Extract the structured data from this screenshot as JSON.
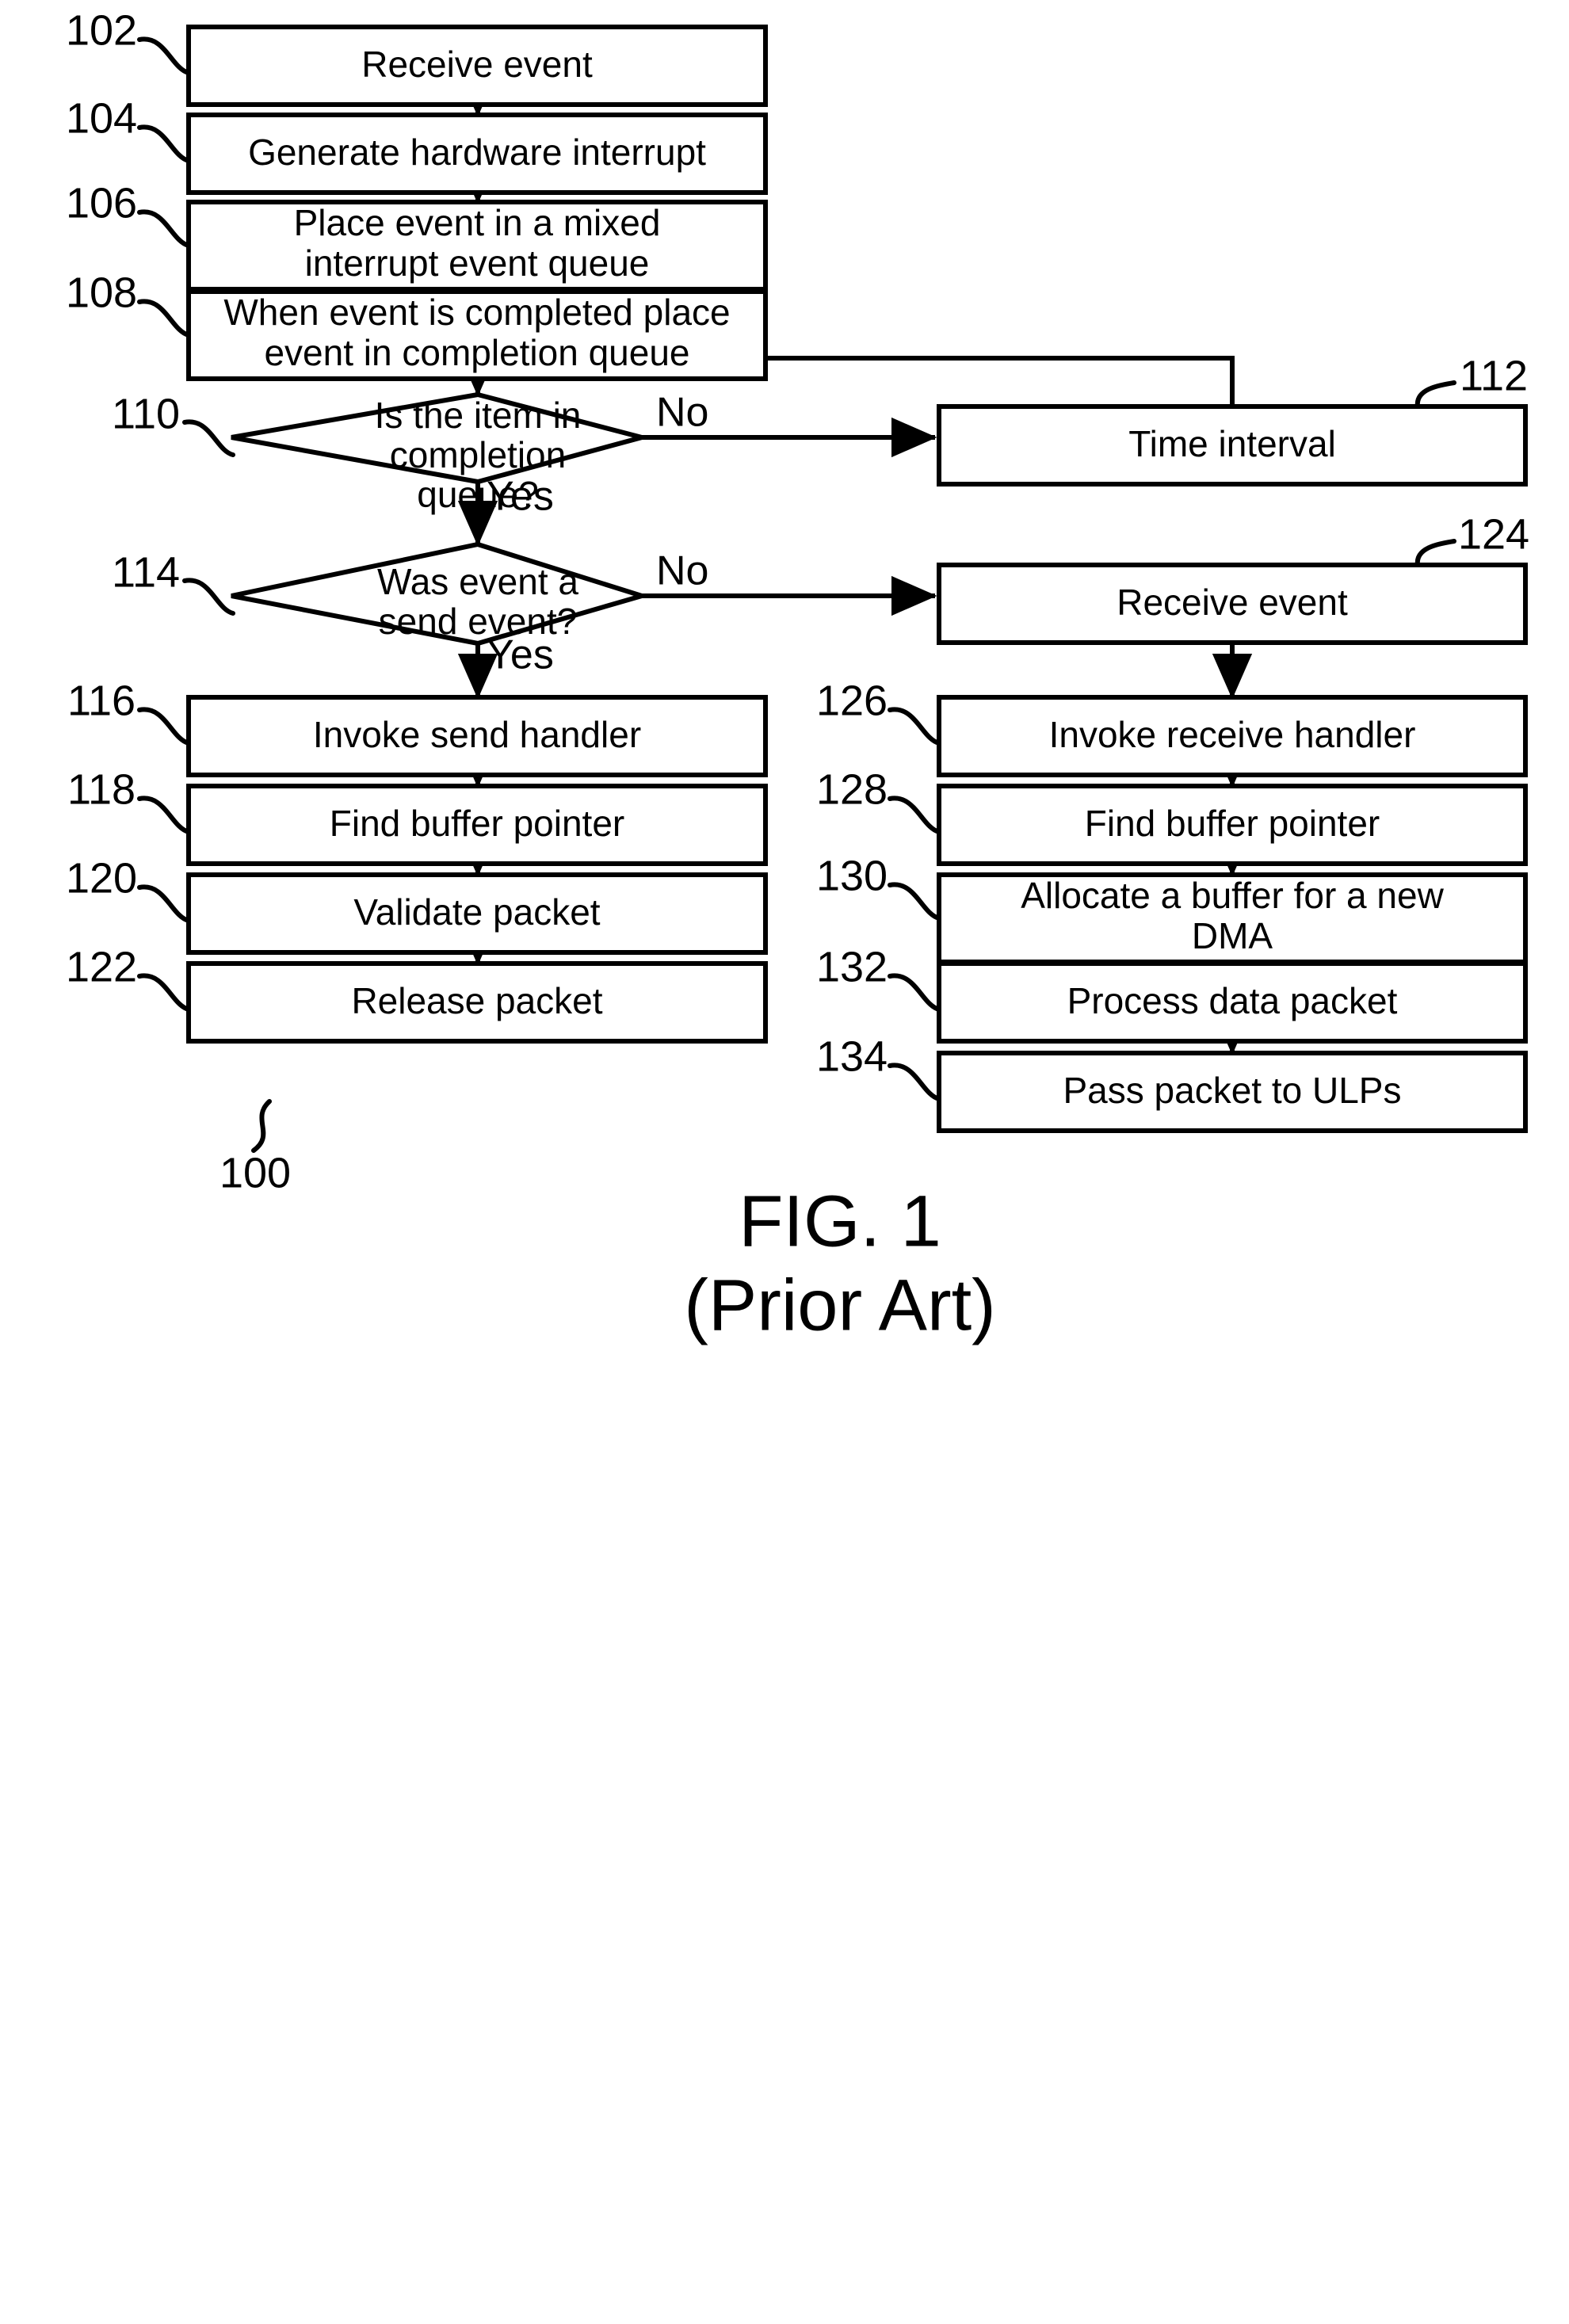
{
  "figure": {
    "caption_line1": "FIG. 1",
    "caption_line2": "(Prior Art)",
    "diagram_ref": "100"
  },
  "nodes": {
    "n102": {
      "ref": "102",
      "label": "Receive event",
      "shape": "process"
    },
    "n104": {
      "ref": "104",
      "label": "Generate hardware interrupt",
      "shape": "process"
    },
    "n106": {
      "ref": "106",
      "label_line1": "Place event in a mixed",
      "label_line2": "interrupt event queue",
      "shape": "process"
    },
    "n108": {
      "ref": "108",
      "label_line1": "When event is completed place",
      "label_line2": "event in completion queue",
      "shape": "process"
    },
    "n110": {
      "ref": "110",
      "label_line1": "Is the item in",
      "label_line2": "completion",
      "label_line3": "queue?",
      "shape": "decision"
    },
    "n112": {
      "ref": "112",
      "label": "Time interval",
      "shape": "process"
    },
    "n114": {
      "ref": "114",
      "label_line1": "Was event a",
      "label_line2": "send event?",
      "shape": "decision"
    },
    "n116": {
      "ref": "116",
      "label": "Invoke send handler",
      "shape": "process"
    },
    "n118": {
      "ref": "118",
      "label": "Find buffer pointer",
      "shape": "process"
    },
    "n120": {
      "ref": "120",
      "label": "Validate packet",
      "shape": "process"
    },
    "n122": {
      "ref": "122",
      "label": "Release packet",
      "shape": "process"
    },
    "n124": {
      "ref": "124",
      "label": "Receive event",
      "shape": "process"
    },
    "n126": {
      "ref": "126",
      "label": "Invoke receive handler",
      "shape": "process"
    },
    "n128": {
      "ref": "128",
      "label": "Find buffer pointer",
      "shape": "process"
    },
    "n130": {
      "ref": "130",
      "label_line1": "Allocate a buffer for a new",
      "label_line2": "DMA",
      "shape": "process"
    },
    "n132": {
      "ref": "132",
      "label": "Process data packet",
      "shape": "process"
    },
    "n134": {
      "ref": "134",
      "label": "Pass packet to ULPs",
      "shape": "process"
    }
  },
  "branches": {
    "b110_no": "No",
    "b110_yes": "Yes",
    "b114_no": "No",
    "b114_yes": "Yes"
  },
  "colors": {
    "stroke": "#000000",
    "fill": "#ffffff",
    "background": "#ffffff"
  }
}
